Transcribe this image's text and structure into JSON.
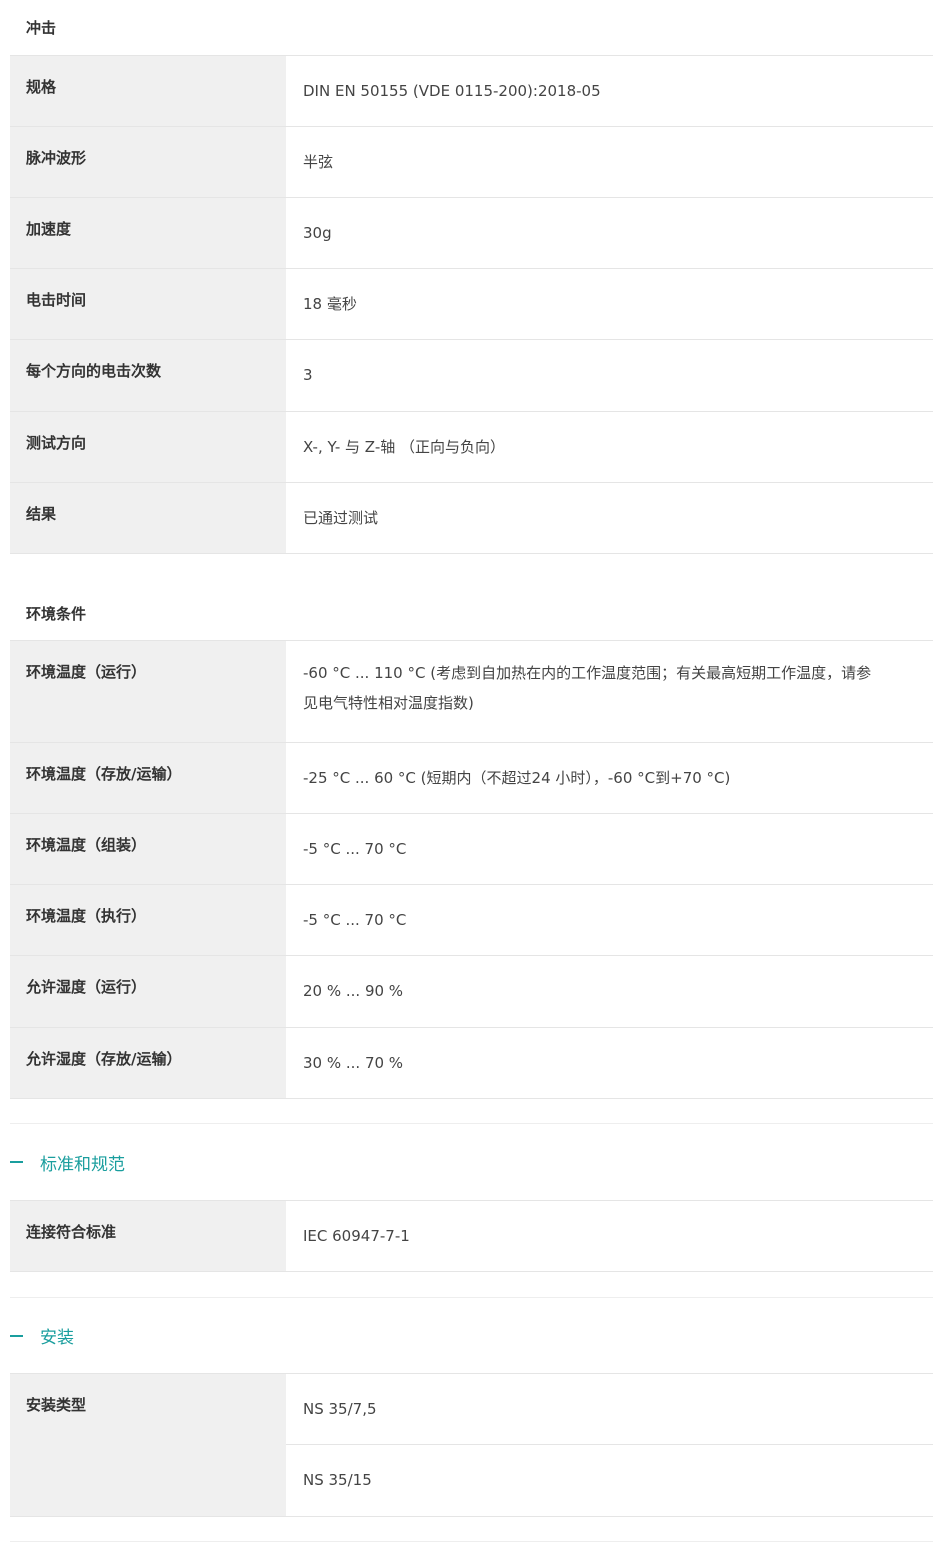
{
  "shock": {
    "title": "冲击",
    "rows": [
      {
        "label": "规格",
        "value": "DIN EN 50155 (VDE 0115-200):2018-05"
      },
      {
        "label": "脉冲波形",
        "value": "半弦"
      },
      {
        "label": "加速度",
        "value": "30g"
      },
      {
        "label": "电击时间",
        "value": "18 毫秒"
      },
      {
        "label": "每个方向的电击次数",
        "value": "3"
      },
      {
        "label": "测试方向",
        "value": "X-, Y- 与 Z-轴 （正向与负向）"
      },
      {
        "label": "结果",
        "value": "已通过测试"
      }
    ]
  },
  "environment": {
    "title": "环境条件",
    "rows": [
      {
        "label": "环境温度（运行）",
        "value": "-60 °C ... 110 °C (考虑到自加热在内的工作温度范围；有关最高短期工作温度，请参",
        "value2": "见电气特性相对温度指数)"
      },
      {
        "label": "环境温度（存放/运输）",
        "value": "-25 °C ... 60 °C (短期内（不超过24  小时），-60 °C到+70 °C)"
      },
      {
        "label": "环境温度（组装）",
        "value": "-5 °C ... 70 °C"
      },
      {
        "label": "环境温度（执行）",
        "value": "-5 °C ... 70 °C"
      },
      {
        "label": "允许湿度（运行）",
        "value": "20 % ... 90 %"
      },
      {
        "label": "允许湿度（存放/运输）",
        "value": "30 % ... 70 %"
      }
    ]
  },
  "standards": {
    "title": "标准和规范",
    "rows": [
      {
        "label": "连接符合标准",
        "value": "IEC 60947-7-1"
      }
    ]
  },
  "mounting": {
    "title": "安装",
    "label": "安装类型",
    "values": [
      "NS 35/7,5",
      "NS 35/15"
    ]
  },
  "colors": {
    "accent": "#1a9e9e",
    "label_bg": "#f0f0f0",
    "border": "#e5e5e5"
  }
}
